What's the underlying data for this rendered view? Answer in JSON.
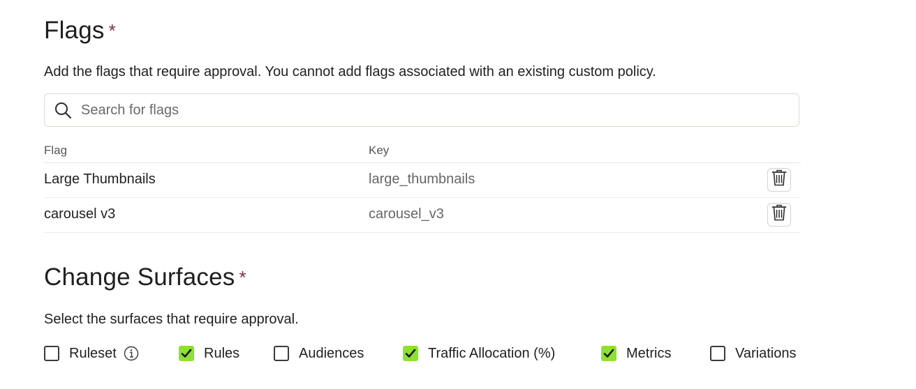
{
  "flags_section": {
    "title": "Flags",
    "required_marker": "*",
    "description": "Add the flags that require approval. You cannot add flags associated with an existing custom policy.",
    "search": {
      "placeholder": "Search for flags",
      "value": ""
    },
    "table": {
      "columns": [
        "Flag",
        "Key"
      ],
      "rows": [
        {
          "flag": "Large Thumbnails",
          "key": "large_thumbnails"
        },
        {
          "flag": "carousel v3",
          "key": "carousel_v3"
        }
      ]
    }
  },
  "surfaces_section": {
    "title": "Change Surfaces",
    "required_marker": "*",
    "description": "Select the surfaces that require approval.",
    "options": [
      {
        "label": "Ruleset",
        "checked": false,
        "info": true
      },
      {
        "label": "Rules",
        "checked": true
      },
      {
        "label": "Audiences",
        "checked": false
      },
      {
        "label": "Traffic Allocation (%)",
        "checked": true
      },
      {
        "label": "Metrics",
        "checked": true
      },
      {
        "label": "Variations",
        "checked": false
      }
    ]
  },
  "colors": {
    "checked": "#8ee033",
    "required": "#7a2f4f"
  }
}
